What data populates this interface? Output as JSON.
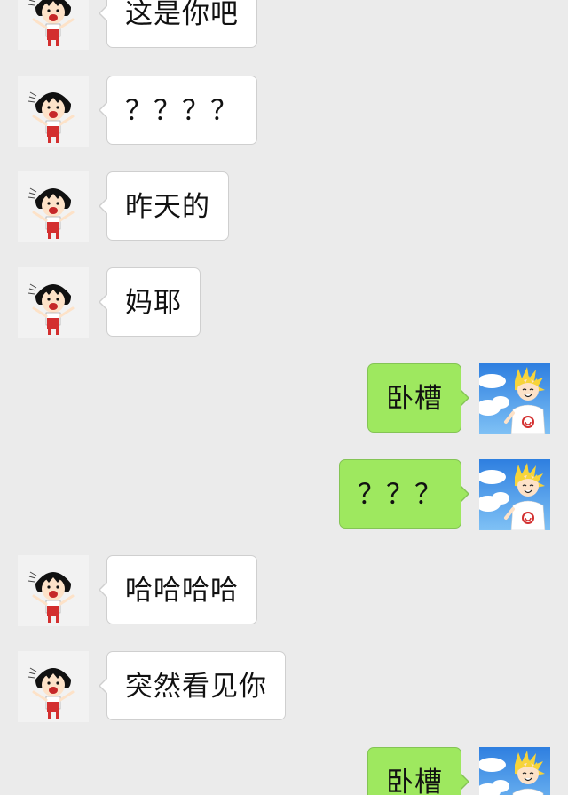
{
  "chat": {
    "messages": [
      {
        "sender": "other",
        "avatar": "girl-avatar-icon",
        "text": "这是你吧"
      },
      {
        "sender": "other",
        "avatar": "girl-avatar-icon",
        "text": "？？？？"
      },
      {
        "sender": "other",
        "avatar": "girl-avatar-icon",
        "text": "昨天的"
      },
      {
        "sender": "other",
        "avatar": "girl-avatar-icon",
        "text": "妈耶"
      },
      {
        "sender": "self",
        "avatar": "blond-boy-avatar-icon",
        "text": "卧槽"
      },
      {
        "sender": "self",
        "avatar": "blond-boy-avatar-icon",
        "text": "？？？"
      },
      {
        "sender": "other",
        "avatar": "girl-avatar-icon",
        "text": "哈哈哈哈"
      },
      {
        "sender": "other",
        "avatar": "girl-avatar-icon",
        "text": "突然看见你"
      },
      {
        "sender": "self",
        "avatar": "blond-boy-avatar-icon",
        "text": "卧槽"
      }
    ]
  },
  "colors": {
    "background": "#ebebeb",
    "incoming_bubble": "#ffffff",
    "outgoing_bubble": "#9ee85f"
  }
}
